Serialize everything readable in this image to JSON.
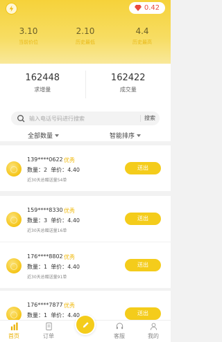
{
  "header": {
    "balance": "0.42",
    "stats": [
      {
        "value": "3.10",
        "label": "当前价位"
      },
      {
        "value": "2.10",
        "label": "历史最低"
      },
      {
        "value": "4.4",
        "label": "历史最高"
      }
    ]
  },
  "summary": {
    "demand": {
      "value": "162448",
      "label": "求增量"
    },
    "deals": {
      "value": "162422",
      "label": "成交量"
    }
  },
  "search": {
    "placeholder": "输入电话号码进行搜索",
    "button": "搜索"
  },
  "filters": {
    "quantity": "全部数量",
    "sort": "智能排序"
  },
  "orders": [
    {
      "phone": "139****0622",
      "badge": "优秀",
      "qty_label": "数量：",
      "qty": "2",
      "price_label": "单价：",
      "price": "4.40",
      "note": "近30天总赠送量54单",
      "action": "送出"
    },
    {
      "phone": "159****8330",
      "badge": "优秀",
      "qty_label": "数量：",
      "qty": "3",
      "price_label": "单价：",
      "price": "4.40",
      "note": "近30天总赠送量16单",
      "action": "送出"
    },
    {
      "phone": "176****8802",
      "badge": "优秀",
      "qty_label": "数量：",
      "qty": "1",
      "price_label": "单价：",
      "price": "4.40",
      "note": "近30天总赠送量91单",
      "action": "送出"
    },
    {
      "phone": "176****7877",
      "badge": "优秀",
      "qty_label": "数量：",
      "qty": "1",
      "price_label": "单价：",
      "price": "4.40",
      "note": "",
      "action": "送出"
    }
  ],
  "tabbar": {
    "home": "首页",
    "orders": "订单",
    "service": "客服",
    "mine": "我的",
    "active_color": "#e9b000"
  },
  "icons": [
    "logo-icon",
    "diamond-icon",
    "search-icon",
    "chevron-down-icon",
    "bar-chart-icon",
    "document-icon",
    "pencil-icon",
    "headset-icon",
    "person-icon"
  ]
}
